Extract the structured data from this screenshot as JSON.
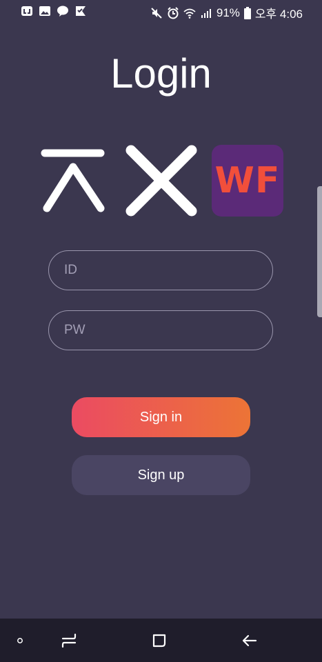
{
  "status_bar": {
    "battery": "91%",
    "time": "오후 4:06",
    "icons_left": [
      "sync-icon",
      "image-icon",
      "talk-icon",
      "checkmark-flag-icon"
    ],
    "icons_right": [
      "mute-icon",
      "alarm-icon",
      "wifi-icon",
      "signal-icon",
      "battery-icon"
    ]
  },
  "screen": {
    "title": "Login",
    "logo_badge": "WF",
    "id_field": {
      "placeholder": "ID",
      "value": ""
    },
    "pw_field": {
      "placeholder": "PW",
      "value": ""
    },
    "signin_label": "Sign in",
    "signup_label": "Sign up"
  },
  "colors": {
    "background": "#3b374f",
    "signin_gradient_start": "#eb4b62",
    "signin_gradient_end": "#ec7436",
    "signup_bg": "#4a4563",
    "logo_badge_bg": "#5b2a78",
    "logo_badge_text": "#f14f3b"
  },
  "nav_bar": {
    "icons": [
      "dot-icon",
      "recents-icon",
      "home-icon",
      "back-icon"
    ]
  }
}
